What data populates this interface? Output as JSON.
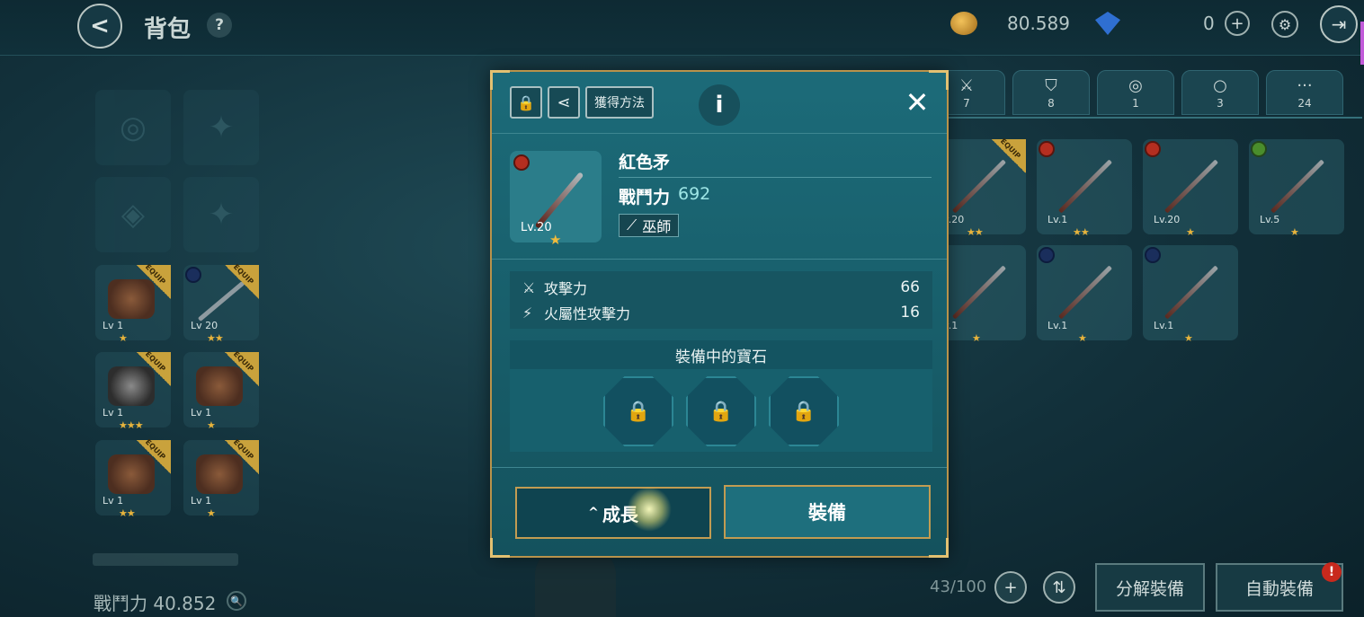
{
  "header": {
    "title": "背包",
    "gold": "80.589",
    "gems": "0"
  },
  "player": {
    "combat_power": "戰鬥力 40.852"
  },
  "left_slots": [
    {
      "level": "Lv 1",
      "stars": "★"
    },
    {
      "level": "Lv 20",
      "stars": "★★"
    },
    {
      "level": "Lv 1",
      "stars": "★★★"
    },
    {
      "level": "Lv 1",
      "stars": "★"
    },
    {
      "level": "Lv 1",
      "stars": "★★"
    },
    {
      "level": "Lv 1",
      "stars": "★"
    }
  ],
  "equip_tag": "EQUIP",
  "category_tabs": [
    {
      "icon": "spear-icon",
      "count": "7"
    },
    {
      "icon": "shield-icon",
      "count": "8"
    },
    {
      "icon": "necklace-icon",
      "count": "1"
    },
    {
      "icon": "ring-icon",
      "count": "3"
    },
    {
      "icon": "more-icon",
      "count": "24"
    }
  ],
  "inventory": [
    {
      "level": "Lv.20",
      "stars": "★★",
      "element": "none",
      "equipped": true
    },
    {
      "level": "Lv.1",
      "stars": "★★",
      "element": "fire"
    },
    {
      "level": "Lv.20",
      "stars": "★",
      "element": "fire"
    },
    {
      "level": "Lv.5",
      "stars": "★",
      "element": "leaf"
    },
    {
      "level": "Lv.1",
      "stars": "★",
      "element": "none"
    },
    {
      "level": "Lv.1",
      "stars": "★",
      "element": "water"
    },
    {
      "level": "Lv.1",
      "stars": "★",
      "element": "water"
    }
  ],
  "footer": {
    "count": "43/100",
    "disassemble_label": "分解裝備",
    "auto_equip_label": "自動裝備",
    "alert": "!"
  },
  "modal": {
    "acquire_label": "獲得方法",
    "item_name": "紅色矛",
    "item_level": "Lv.20",
    "combat_power_label": "戰鬥力",
    "combat_power_value": "692",
    "class_label": "巫師",
    "stats": [
      {
        "label": "攻擊力",
        "value": "66",
        "icon": "crossed-swords-icon"
      },
      {
        "label": "火屬性攻擊力",
        "value": "16",
        "icon": "fire-sword-icon"
      }
    ],
    "gem_header": "裝備中的寶石",
    "grow_label": "成長",
    "equip_label": "裝備"
  },
  "colors": {
    "accent_gold": "#c29c52",
    "modal_bg": "#1c6b79",
    "fire": "#b42e20",
    "water": "#1a2e5c",
    "leaf": "#4a8d2c"
  }
}
